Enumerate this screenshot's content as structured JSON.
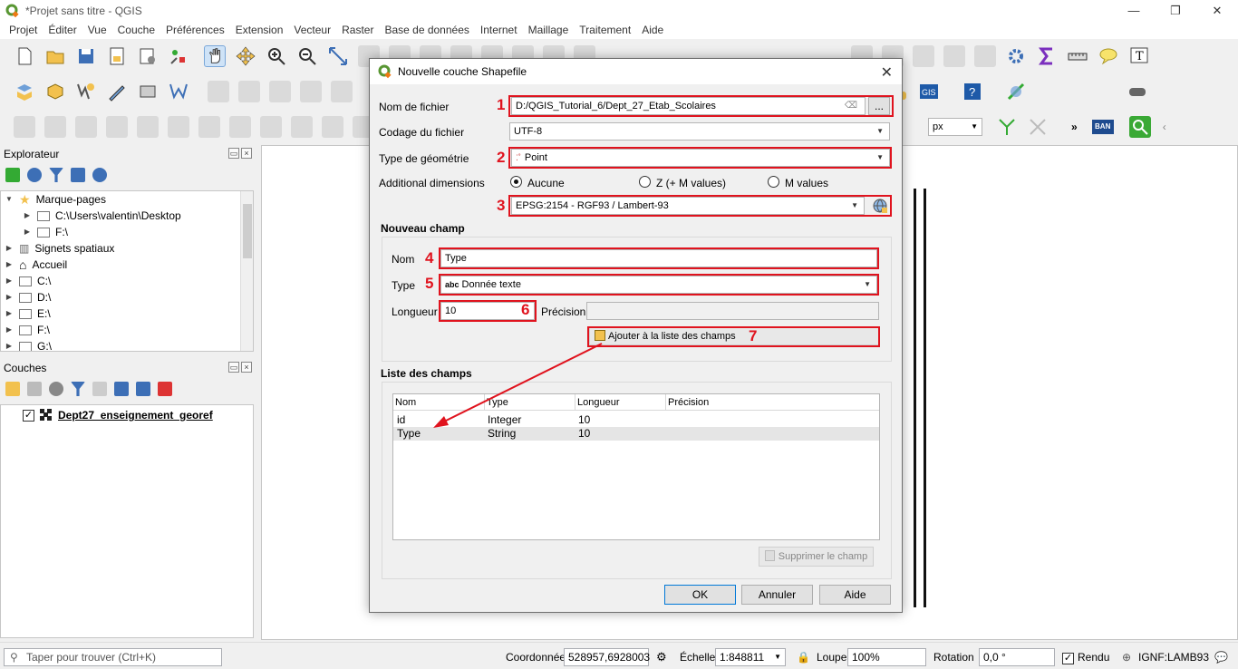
{
  "window": {
    "title": "*Projet sans titre - QGIS",
    "minimize": "—",
    "maximize": "❐",
    "close": "✕"
  },
  "menu": [
    "Projet",
    "Éditer",
    "Vue",
    "Couche",
    "Préférences",
    "Extension",
    "Vecteur",
    "Raster",
    "Base de données",
    "Internet",
    "Maillage",
    "Traitement",
    "Aide"
  ],
  "explorer": {
    "title": "Explorateur",
    "items": [
      {
        "label": "Marque-pages",
        "level": 0,
        "expanded": true,
        "icon": "star-icon"
      },
      {
        "label": "C:\\Users\\valentin\\Desktop",
        "level": 1,
        "icon": "folder-icon"
      },
      {
        "label": "F:\\",
        "level": 1,
        "icon": "folder-icon"
      },
      {
        "label": "Signets spatiaux",
        "level": 0,
        "icon": "spatial-bookmark-icon"
      },
      {
        "label": "Accueil",
        "level": 0,
        "icon": "home-icon"
      },
      {
        "label": "C:\\",
        "level": 0,
        "icon": "drive-icon"
      },
      {
        "label": "D:\\",
        "level": 0,
        "icon": "drive-icon"
      },
      {
        "label": "E:\\",
        "level": 0,
        "icon": "drive-icon"
      },
      {
        "label": "F:\\",
        "level": 0,
        "icon": "drive-icon"
      },
      {
        "label": "G:\\",
        "level": 0,
        "icon": "drive-icon"
      }
    ]
  },
  "layers": {
    "title": "Couches",
    "items": [
      {
        "label": "Dept27_enseignement_georef",
        "checked": true
      }
    ]
  },
  "dialog": {
    "title": "Nouvelle couche Shapefile",
    "filename_label": "Nom de fichier",
    "filename_value": "D:/QGIS_Tutorial_6/Dept_27_Etab_Scolaires",
    "browse_label": "...",
    "encoding_label": "Codage du fichier",
    "encoding_value": "UTF-8",
    "geometry_label": "Type de géométrie",
    "geometry_value": "Point",
    "dimensions_label": "Additional dimensions",
    "dim_options": [
      "Aucune",
      "Z (+ M values)",
      "M values"
    ],
    "dim_selected": 0,
    "crs_value": "EPSG:2154 - RGF93 / Lambert-93",
    "new_field_title": "Nouveau champ",
    "name_label": "Nom",
    "name_value": "Type",
    "type_label": "Type",
    "type_prefix": "abc",
    "type_value": "Donnée texte",
    "length_label": "Longueur",
    "length_value": "10",
    "precision_label": "Précision",
    "precision_value": "",
    "add_field_button": "Ajouter à la liste des champs",
    "fields_list_title": "Liste des champs",
    "columns": [
      "Nom",
      "Type",
      "Longueur",
      "Précision"
    ],
    "rows": [
      [
        "id",
        "Integer",
        "10",
        ""
      ],
      [
        "Type",
        "String",
        "10",
        ""
      ]
    ],
    "delete_field_button": "Supprimer le champ",
    "ok": "OK",
    "cancel": "Annuler",
    "help": "Aide",
    "annotation_numbers": [
      "1",
      "2",
      "3",
      "4",
      "5",
      "6",
      "7"
    ],
    "annotation_color": "#e0131e"
  },
  "status": {
    "search_placeholder": "Taper pour trouver (Ctrl+K)",
    "coord_label": "Coordonnée",
    "coord_value": "528957,6928003",
    "scale_label": "Échelle",
    "scale_value": "1:848811",
    "zoom_label": "Loupe",
    "zoom_value": "100%",
    "rotation_label": "Rotation",
    "rotation_value": "0,0 °",
    "render_label": "Rendu",
    "crs_label": "IGNF:LAMB93"
  },
  "toolbar3": {
    "unit_value": "px",
    "ban_label": "BAN"
  }
}
